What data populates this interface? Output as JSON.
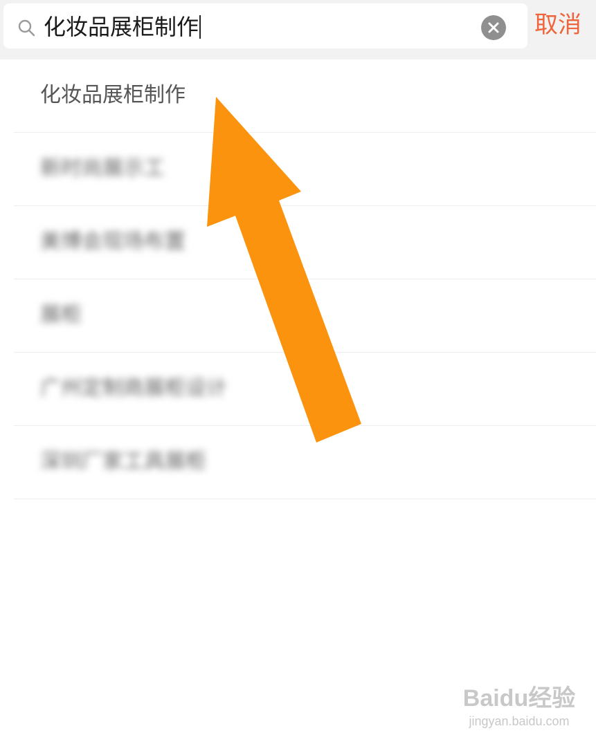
{
  "search": {
    "query": "化妆品展柜制作",
    "cancel_label": "取消"
  },
  "suggestions": [
    {
      "label": "化妆品展柜制作",
      "blurred": false
    },
    {
      "label": "新时尚展示工",
      "blurred": true
    },
    {
      "label": "美博会现场布置",
      "blurred": true
    },
    {
      "label": "展柜",
      "blurred": true
    },
    {
      "label": "广州定制商展柜设计",
      "blurred": true
    },
    {
      "label": "深圳厂家工具展柜",
      "blurred": true
    }
  ],
  "overlay": {
    "arrow_color": "#fb930f",
    "arrow_icon": "arrow-up-left"
  },
  "watermark": {
    "brand": "Baidu经验",
    "url": "jingyan.baidu.com"
  },
  "colors": {
    "accent": "#f0643c",
    "search_bar_bg": "#f2f2f2"
  }
}
